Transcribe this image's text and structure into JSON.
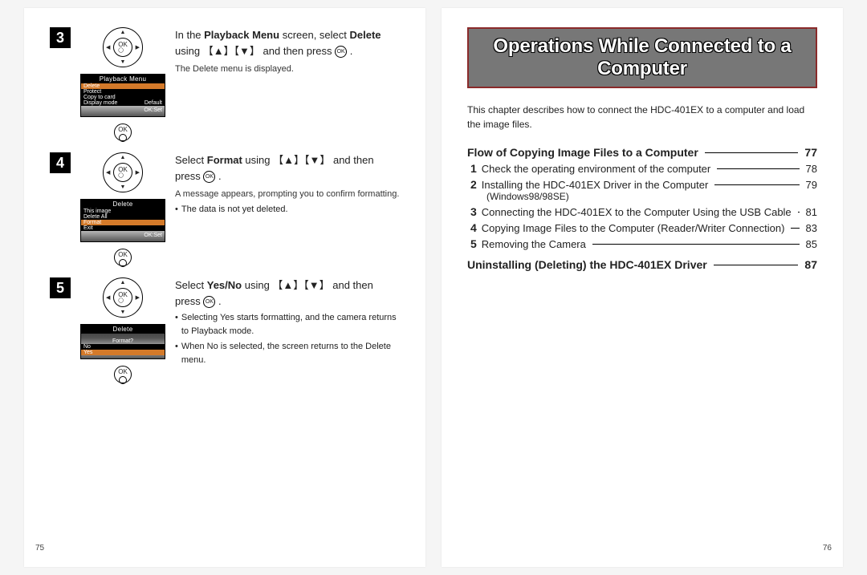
{
  "left": {
    "pageNumber": "75",
    "steps": [
      {
        "num": "3",
        "lcd": {
          "title": "Playback Menu",
          "items": [
            {
              "label": "Delete",
              "sel": true
            },
            {
              "label": "Protect"
            },
            {
              "label": "Copy to card"
            },
            {
              "label": "Display mode",
              "value": "Default"
            }
          ],
          "footer": "OK:Set"
        },
        "head_prefix": "In the ",
        "head_bold1": "Playback Menu",
        "head_mid": " screen, select ",
        "head_bold2": "Delete",
        "head_suffix": " using 【▲】【▼】 and then press ",
        "sub": "The Delete menu is displayed.",
        "bullets": []
      },
      {
        "num": "4",
        "lcd": {
          "title": "Delete",
          "items": [
            {
              "label": "This image"
            },
            {
              "label": "Delete All"
            },
            {
              "label": "Format",
              "sel": true
            },
            {
              "label": "Exit"
            }
          ],
          "footer": "OK:Set"
        },
        "head_prefix": "Select ",
        "head_bold1": "Format",
        "head_mid": " using 【▲】【▼】 and then press ",
        "head_bold2": "",
        "head_suffix": "",
        "sub": "A message appears, prompting you to confirm formatting.",
        "bullets": [
          "The data is not yet deleted."
        ]
      },
      {
        "num": "5",
        "lcd": {
          "title": "Delete",
          "items": [
            {
              "label": "Format?",
              "centered": true
            },
            {
              "label": "No"
            },
            {
              "label": "Yes",
              "sel": true
            }
          ],
          "footer": ""
        },
        "head_prefix": "Select ",
        "head_bold1": "Yes/No",
        "head_mid": " using 【▲】【▼】 and then press ",
        "head_bold2": "",
        "head_suffix": "",
        "sub": "",
        "bullets": [
          "Selecting Yes starts formatting, and the camera returns to Playback mode.",
          "When No is selected, the screen returns to the Delete menu."
        ]
      }
    ]
  },
  "right": {
    "pageNumber": "76",
    "title": "Operations While Connected to a Computer",
    "intro": "This chapter describes how to connect the HDC-401EX to a computer and load the image files.",
    "sections": [
      {
        "head": "Flow of Copying Image Files to a Computer",
        "page": "77",
        "items": [
          {
            "n": "1",
            "text": "Check the operating environment of the computer",
            "page": "78"
          },
          {
            "n": "2",
            "text": "Installing the HDC-401EX Driver in the Computer",
            "sub": "(Windows98/98SE)",
            "page": "79"
          },
          {
            "n": "3",
            "text": "Connecting the HDC-401EX to the Computer Using the USB Cable",
            "page": "81"
          },
          {
            "n": "4",
            "text": "Copying Image Files to the Computer (Reader/Writer Connection)",
            "page": "83"
          },
          {
            "n": "5",
            "text": "Removing the Camera",
            "page": "85"
          }
        ]
      },
      {
        "head": "Uninstalling (Deleting) the HDC-401EX Driver",
        "page": "87",
        "items": []
      }
    ]
  }
}
